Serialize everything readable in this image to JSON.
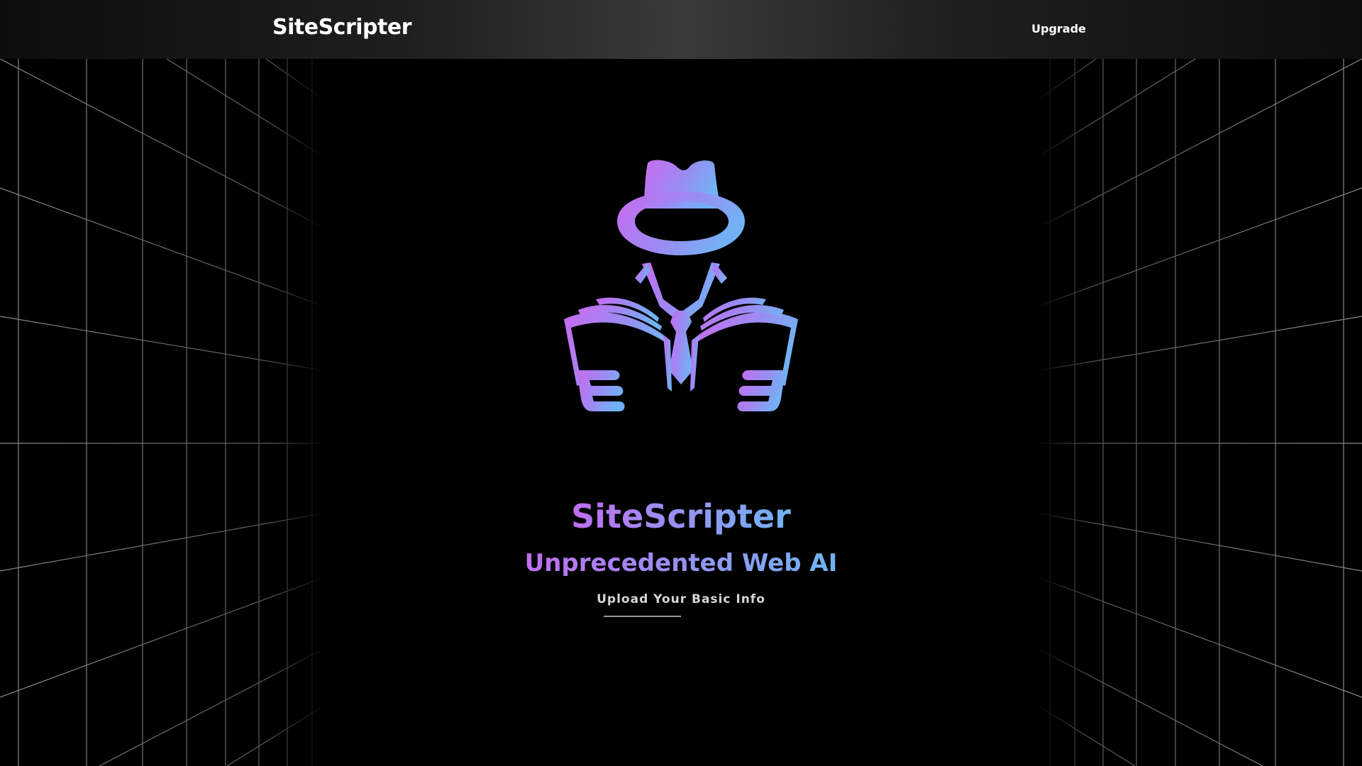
{
  "navbar": {
    "brand": "SiteScripter",
    "upgrade_label": "Upgrade"
  },
  "hero": {
    "logo_icon": "detective-reading-newspaper-icon",
    "title": "SiteScripter",
    "subtitle": "Unprecedented Web AI",
    "cta_label": "Upload Your Basic Info"
  },
  "colors": {
    "background": "#000000",
    "gradient_start": "#c06ef0",
    "gradient_end": "#6fb4f2",
    "grid_line": "#8a8a8a"
  }
}
